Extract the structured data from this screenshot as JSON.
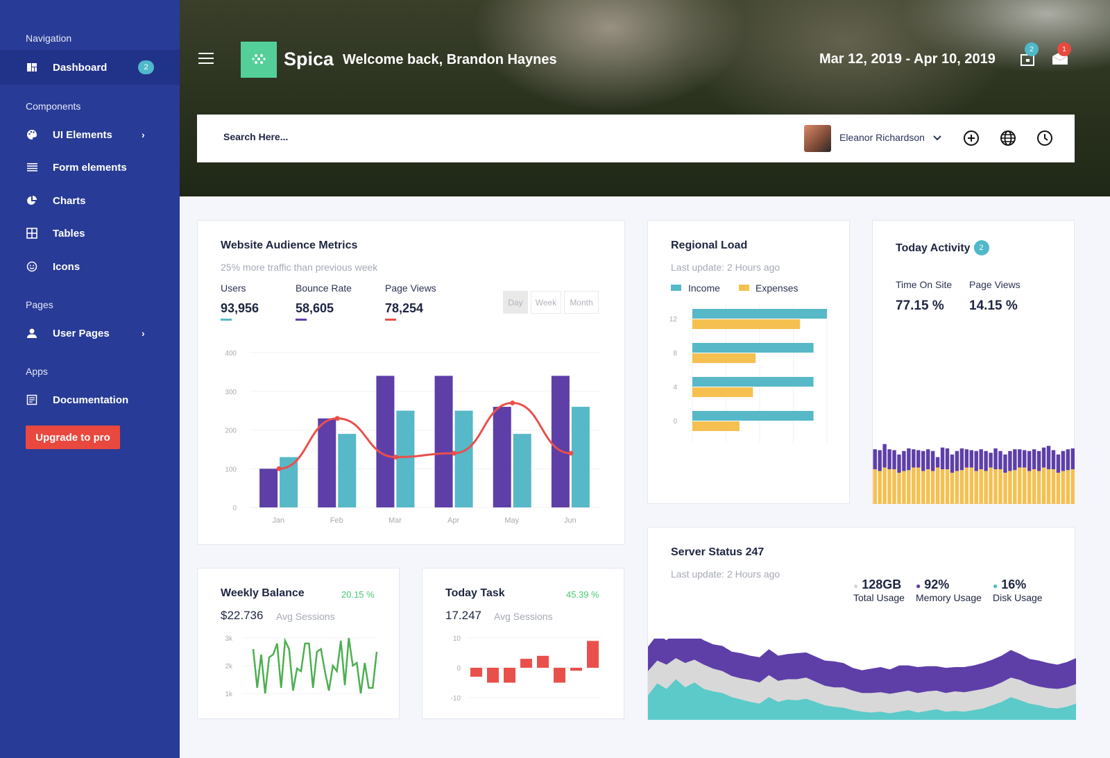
{
  "sidebar": {
    "sections": [
      "Navigation",
      "Components",
      "Pages",
      "Apps"
    ],
    "items": [
      {
        "label": "Dashboard",
        "icon": "dashboard-icon",
        "badge": "2"
      },
      {
        "label": "UI Elements",
        "icon": "palette-icon"
      },
      {
        "label": "Form elements",
        "icon": "list-icon"
      },
      {
        "label": "Charts",
        "icon": "pie-chart-icon"
      },
      {
        "label": "Tables",
        "icon": "table-icon"
      },
      {
        "label": "Icons",
        "icon": "smiley-icon"
      },
      {
        "label": "User Pages",
        "icon": "user-icon"
      },
      {
        "label": "Documentation",
        "icon": "document-icon"
      }
    ],
    "upgrade_label": "Upgrade to pro"
  },
  "header": {
    "brand": "Spica",
    "welcome": "Welcome back, Brandon Haynes",
    "date_range": "Mar 12, 2019 - Apr 10, 2019",
    "inbox_badge": "2",
    "mail_badge": "1"
  },
  "search": {
    "placeholder": "Search Here..."
  },
  "user": {
    "name": "Eleanor Richardson"
  },
  "colors": {
    "sidebar": "#283b96",
    "purple": "#5e3fa8",
    "teal": "#57b8c8",
    "red": "#e9504b",
    "yellow": "#f5c050",
    "green": "#4caf50",
    "grey": "#d8d8d8",
    "server_teal": "#5ccac9"
  },
  "audience": {
    "title": "Website Audience Metrics",
    "subtitle": "25% more traffic than previous week",
    "stats": [
      {
        "label": "Users",
        "value": "93,956"
      },
      {
        "label": "Bounce Rate",
        "value": "58,605"
      },
      {
        "label": "Page Views",
        "value": "78,254"
      }
    ],
    "ranges": [
      "Day",
      "Week",
      "Month"
    ],
    "active_range": "Day"
  },
  "regional": {
    "title": "Regional Load",
    "subtitle": "Last update: 2 Hours ago",
    "legend": [
      "Income",
      "Expenses"
    ]
  },
  "activity": {
    "title": "Today Activity",
    "badge": "2",
    "stats": [
      {
        "label": "Time On Site",
        "value": "77.15 %"
      },
      {
        "label": "Page Views",
        "value": "14.15 %"
      }
    ]
  },
  "weekly": {
    "title": "Weekly Balance",
    "change": "20.15 %",
    "value": "$22.736",
    "value_label": "Avg Sessions"
  },
  "task": {
    "title": "Today Task",
    "change": "45.39 %",
    "value": "17.247",
    "value_label": "Avg Sessions"
  },
  "server": {
    "title": "Server Status 247",
    "subtitle": "Last update: 2 Hours ago",
    "stats": [
      {
        "value": "128GB",
        "label": "Total Usage"
      },
      {
        "value": "92%",
        "label": "Memory Usage"
      },
      {
        "value": "16%",
        "label": "Disk Usage"
      }
    ]
  },
  "chart_data": [
    {
      "id": "audience",
      "type": "bar",
      "categories": [
        "Jan",
        "Feb",
        "Mar",
        "Apr",
        "May",
        "Jun"
      ],
      "ylim": [
        0,
        400
      ],
      "yticks": [
        "0",
        "100",
        "200",
        "300",
        "400"
      ],
      "series": [
        {
          "type": "bar",
          "values": [
            100,
            230,
            340,
            340,
            260,
            340
          ]
        },
        {
          "type": "bar",
          "values": [
            130,
            190,
            250,
            250,
            190,
            260
          ]
        },
        {
          "type": "line",
          "values": [
            100,
            230,
            130,
            140,
            270,
            140
          ]
        }
      ]
    },
    {
      "id": "regional",
      "type": "bar",
      "orientation": "horizontal",
      "categories": [
        "12",
        "8",
        "4",
        "0"
      ],
      "xlim": [
        0,
        10
      ],
      "series": [
        {
          "name": "Income",
          "values": [
            10,
            9,
            9,
            9
          ]
        },
        {
          "name": "Expenses",
          "values": [
            8,
            4.7,
            4.5,
            3.5
          ]
        }
      ]
    },
    {
      "id": "activity",
      "type": "bar",
      "stacked": true,
      "series": [
        {
          "values": [
            40,
            38,
            42,
            40,
            40,
            36,
            38,
            39,
            42,
            42,
            38,
            40,
            38,
            42,
            40,
            40,
            36,
            38,
            39,
            42,
            42,
            38,
            40,
            38,
            42,
            40,
            40,
            36,
            38,
            39,
            42,
            42,
            38,
            40,
            38,
            42,
            40,
            40,
            36,
            38,
            39,
            40
          ]
        },
        {
          "values": [
            23,
            24,
            27,
            23,
            22,
            21,
            23,
            25,
            21,
            20,
            23,
            23,
            23,
            12,
            25,
            24,
            21,
            23,
            25,
            21,
            20,
            23,
            23,
            23,
            17,
            24,
            21,
            21,
            23,
            24,
            21,
            20,
            23,
            23,
            23,
            23,
            27,
            22,
            21,
            23,
            24,
            24
          ]
        }
      ]
    },
    {
      "id": "weekly",
      "type": "line",
      "ylim": [
        1000,
        3000
      ],
      "yticks": [
        "1k",
        "2k",
        "3k"
      ],
      "values": [
        2600,
        1200,
        2400,
        1000,
        2300,
        2400,
        2800,
        1200,
        2900,
        2600,
        1100,
        1900,
        1800,
        2800,
        2800,
        1200,
        2500,
        2600,
        1800,
        1100,
        2000,
        1800,
        2900,
        1300,
        3000,
        2000,
        2100,
        1000,
        2100,
        1200,
        1200,
        2500
      ]
    },
    {
      "id": "task",
      "type": "bar",
      "ylim": [
        -10,
        10
      ],
      "yticks": [
        "-10",
        "0",
        "10"
      ],
      "values": [
        -3,
        -5,
        -5,
        3,
        4,
        -5,
        -1,
        9
      ]
    },
    {
      "id": "server",
      "type": "area",
      "stacked": true,
      "series": [
        {
          "values": [
            30,
            45,
            38,
            50,
            40,
            46,
            38,
            35,
            33,
            28,
            25,
            22,
            20,
            28,
            22,
            25,
            24,
            26,
            22,
            18,
            16,
            15,
            12,
            10,
            9,
            10,
            8,
            10,
            12,
            9,
            11,
            13,
            10,
            11,
            10,
            12,
            14,
            18,
            22,
            28,
            24,
            20,
            18,
            15,
            14,
            16,
            20
          ]
        },
        {
          "values": [
            30,
            28,
            30,
            26,
            30,
            28,
            30,
            28,
            27,
            26,
            26,
            27,
            26,
            27,
            26,
            25,
            26,
            26,
            25,
            24,
            24,
            25,
            24,
            23,
            24,
            24,
            24,
            24,
            24,
            24,
            24,
            23,
            23,
            24,
            24,
            24,
            24,
            23,
            24,
            24,
            25,
            24,
            23,
            24,
            24,
            24,
            24
          ]
        },
        {
          "values": [
            30,
            32,
            30,
            33,
            30,
            31,
            30,
            30,
            31,
            30,
            31,
            30,
            31,
            32,
            31,
            31,
            32,
            31,
            31,
            31,
            32,
            30,
            28,
            28,
            30,
            31,
            30,
            33,
            31,
            32,
            31,
            30,
            31,
            30,
            31,
            31,
            32,
            33,
            33,
            34,
            32,
            31,
            32,
            31,
            30,
            31,
            32
          ]
        }
      ]
    }
  ]
}
